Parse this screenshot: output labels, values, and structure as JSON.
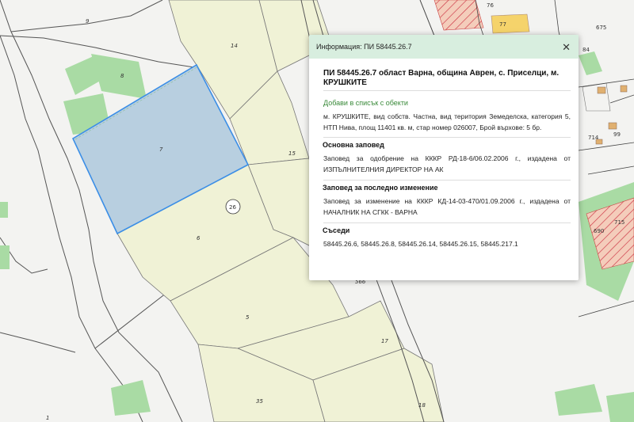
{
  "map": {
    "parcels": [
      {
        "id": "p9",
        "label": "9"
      },
      {
        "id": "p8",
        "label": "8"
      },
      {
        "id": "p14",
        "label": "14"
      },
      {
        "id": "p7",
        "label": "7"
      },
      {
        "id": "p15",
        "label": "15"
      },
      {
        "id": "p6",
        "label": "6"
      },
      {
        "id": "p5",
        "label": "5"
      },
      {
        "id": "p17",
        "label": "17"
      },
      {
        "id": "p35",
        "label": "35"
      },
      {
        "id": "p18",
        "label": "18"
      },
      {
        "id": "p566",
        "label": "566"
      },
      {
        "id": "p1",
        "label": "1"
      },
      {
        "id": "p76",
        "label": "76"
      },
      {
        "id": "p77",
        "label": "77"
      },
      {
        "id": "p84",
        "label": "84"
      },
      {
        "id": "p675",
        "label": "675"
      },
      {
        "id": "p714",
        "label": "714"
      },
      {
        "id": "p99",
        "label": "99"
      },
      {
        "id": "p715",
        "label": "715"
      },
      {
        "id": "p690",
        "label": "690"
      }
    ],
    "locality_number": "26",
    "colors": {
      "selected_fill": "#b8cfe0",
      "selected_stroke": "#3b8ee6",
      "agri_fill": "#f0f2d6",
      "green_fill": "#a9dba4",
      "hatch_fill": "#f2c2b0",
      "hatch_stroke": "#cc3344"
    }
  },
  "info": {
    "header_title": "Информация: ПИ 58445.26.7",
    "close_label": "✕",
    "title": "ПИ 58445.26.7 област Варна, община Аврен, с. Приселци, м. КРУШКИТЕ",
    "add_link": "Добави в списък с обекти",
    "description": "м. КРУШКИТЕ, вид собств. Частна, вид територия Земеделска, категория 5, НТП Нива, площ 11401 кв. м, стар номер 026007, Брой върхове: 5 бр.",
    "sections": [
      {
        "heading": "Основна заповед",
        "text": "Заповед за одобрение на КККР РД-18-6/06.02.2006 г., издадена от ИЗПЪЛНИТЕЛНИЯ ДИРЕКТОР НА АК"
      },
      {
        "heading": "Заповед за последно изменение",
        "text": "Заповед за изменение на КККР КД-14-03-470/01.09.2006 г., издадена от НАЧАЛНИК НА СГКК - ВАРНА"
      },
      {
        "heading": "Съседи",
        "text": "58445.26.6, 58445.26.8, 58445.26.14, 58445.26.15, 58445.217.1"
      }
    ]
  }
}
